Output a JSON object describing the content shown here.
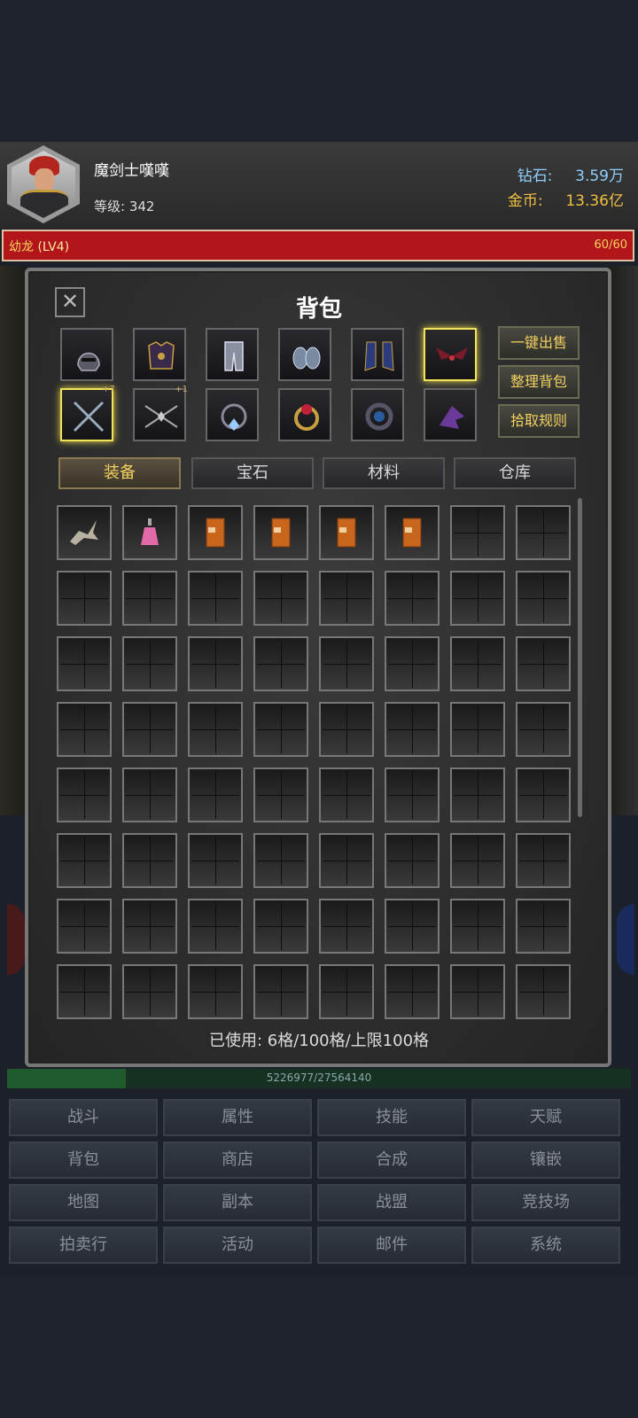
{
  "player": {
    "name": "魔剑士嘆嘆",
    "level": "等级: 342",
    "diamond_label": "钻石:",
    "diamond_value": "3.59万",
    "gold_label": "金币:",
    "gold_value": "13.36亿"
  },
  "dragon": {
    "name": "幼龙",
    "level": "(LV4)",
    "hp": "60/60"
  },
  "bag": {
    "title": "背包",
    "equipment": [
      {
        "icon": "helmet-icon"
      },
      {
        "icon": "chest-armor-icon"
      },
      {
        "icon": "leg-armor-icon"
      },
      {
        "icon": "gauntlets-icon"
      },
      {
        "icon": "boots-icon"
      },
      {
        "icon": "wings-icon",
        "highlight": true
      },
      {
        "icon": "crossed-blades-icon",
        "highlight": true,
        "plus": "+7"
      },
      {
        "icon": "crossed-spears-icon",
        "plus": "+1"
      },
      {
        "icon": "necklace-icon"
      },
      {
        "icon": "ruby-ring-icon"
      },
      {
        "icon": "sapphire-ring-icon"
      },
      {
        "icon": "pet-dragon-icon"
      }
    ],
    "side_buttons": [
      "一键出售",
      "整理背包",
      "拾取规则"
    ],
    "tabs": [
      "装备",
      "宝石",
      "材料",
      "仓库"
    ],
    "items": [
      {
        "icon": "bone-dragon-mount-icon"
      },
      {
        "icon": "pink-potion-icon"
      },
      {
        "icon": "orange-book-icon"
      },
      {
        "icon": "orange-book-icon"
      },
      {
        "icon": "orange-book-icon"
      },
      {
        "icon": "orange-book-icon"
      }
    ],
    "usage": "已使用: 6格/100格/上限100格"
  },
  "xp": {
    "text": "5226977/27564140",
    "progress": 0.19
  },
  "menu": [
    "战斗",
    "属性",
    "技能",
    "天赋",
    "背包",
    "商店",
    "合成",
    "镶嵌",
    "地图",
    "副本",
    "战盟",
    "竞技场",
    "拍卖行",
    "活动",
    "邮件",
    "系统"
  ]
}
